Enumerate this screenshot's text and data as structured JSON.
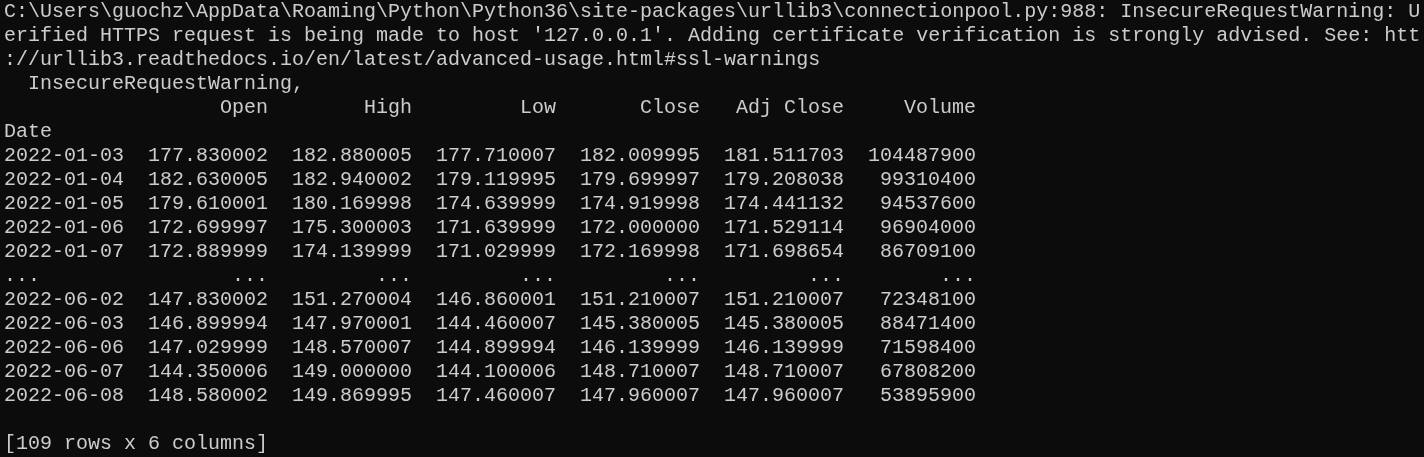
{
  "console_lines": [
    "C:\\Users\\guochz\\AppData\\Roaming\\Python\\Python36\\site-packages\\urllib3\\connectionpool.py:988: InsecureRequestWarning: U",
    "erified HTTPS request is being made to host '127.0.0.1'. Adding certificate verification is strongly advised. See: htt",
    "://urllib3.readthedocs.io/en/latest/advanced-usage.html#ssl-warnings",
    "  InsecureRequestWarning,"
  ],
  "table": {
    "columns": [
      "Open",
      "High",
      "Low",
      "Close",
      "Adj Close",
      "Volume"
    ],
    "index_name": "Date",
    "rows": [
      {
        "index": "2022-01-03",
        "cells": [
          "177.830002",
          "182.880005",
          "177.710007",
          "182.009995",
          "181.511703",
          "104487900"
        ]
      },
      {
        "index": "2022-01-04",
        "cells": [
          "182.630005",
          "182.940002",
          "179.119995",
          "179.699997",
          "179.208038",
          "99310400"
        ]
      },
      {
        "index": "2022-01-05",
        "cells": [
          "179.610001",
          "180.169998",
          "174.639999",
          "174.919998",
          "174.441132",
          "94537600"
        ]
      },
      {
        "index": "2022-01-06",
        "cells": [
          "172.699997",
          "175.300003",
          "171.639999",
          "172.000000",
          "171.529114",
          "96904000"
        ]
      },
      {
        "index": "2022-01-07",
        "cells": [
          "172.889999",
          "174.139999",
          "171.029999",
          "172.169998",
          "171.698654",
          "86709100"
        ]
      },
      {
        "index": "...",
        "cells": [
          "...",
          "...",
          "...",
          "...",
          "...",
          "..."
        ]
      },
      {
        "index": "2022-06-02",
        "cells": [
          "147.830002",
          "151.270004",
          "146.860001",
          "151.210007",
          "151.210007",
          "72348100"
        ]
      },
      {
        "index": "2022-06-03",
        "cells": [
          "146.899994",
          "147.970001",
          "144.460007",
          "145.380005",
          "145.380005",
          "88471400"
        ]
      },
      {
        "index": "2022-06-06",
        "cells": [
          "147.029999",
          "148.570007",
          "144.899994",
          "146.139999",
          "146.139999",
          "71598400"
        ]
      },
      {
        "index": "2022-06-07",
        "cells": [
          "144.350006",
          "149.000000",
          "144.100006",
          "148.710007",
          "148.710007",
          "67808200"
        ]
      },
      {
        "index": "2022-06-08",
        "cells": [
          "148.580002",
          "149.869995",
          "147.460007",
          "147.960007",
          "147.960007",
          "53895900"
        ]
      }
    ]
  },
  "summary": "[109 rows x 6 columns]"
}
